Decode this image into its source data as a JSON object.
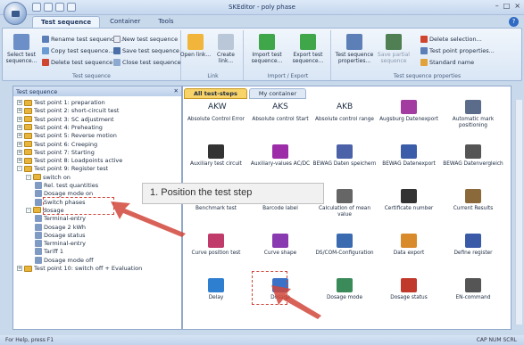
{
  "window": {
    "title": "SKEditor - poly phase",
    "controls": [
      "–",
      "□",
      "×"
    ]
  },
  "ribbon_tabs": [
    "Test sequence",
    "Container",
    "Tools"
  ],
  "ribbon": {
    "test_sequence_group": {
      "label": "Test sequence",
      "select_btn": "Select test sequence...",
      "rename": "Rename test sequence...",
      "copy": "Copy test sequence...",
      "delete": "Delete test sequence...",
      "new": "New test sequence",
      "save": "Save test sequence",
      "close": "Close test sequence"
    },
    "link_group": {
      "label": "Link",
      "open": "Open link...",
      "create": "Create link..."
    },
    "import_group": {
      "label": "Import / Export",
      "import": "Import test sequence...",
      "export": "Export test sequence..."
    },
    "properties_group": {
      "label": "Test sequence properties",
      "props": "Test sequence properties...",
      "save_partial": "Save partial sequence",
      "delete_sel": "Delete selection...",
      "test_point_props": "Test point properties...",
      "standard_name": "Standard name"
    }
  },
  "left_panel": {
    "title": "Test sequence",
    "tree": [
      "Test point 1: preparation",
      "Test point 2: short-circuit test",
      "Test point 3: SC adjustment",
      "Test point 4: Preheating",
      "Test point 5: Reverse motion",
      "Test point 6: Creeping",
      "Test point 7: Starting",
      "Test point 8: Loadpoints active",
      "Test point 9: Register test",
      "switch on",
      "Rel. test quantities",
      "Dosage mode on",
      "Switch phases",
      "dosage",
      "Terminal-entry",
      "Dosage 2 kWh",
      "Dosage status",
      "Terminal-entry",
      "Tariff 1",
      "Dosage mode off",
      "Test point 10: switch off + Evaluation"
    ]
  },
  "doc_tabs": [
    "All test-steps",
    "My container"
  ],
  "steps": [
    "Absolute Control Error",
    "Absolute control Start",
    "Absolute control range",
    "Augsburg Datenexport",
    "Automatic mark positioning",
    "Auxiliary test circuit",
    "Auxiliary-values AC/DC",
    "BEWAG Daten speichern",
    "BEWAG Datenexport",
    "BEWAG Datenvergleich",
    "Benchmark test",
    "Barcode label",
    "Calculation of mean value",
    "Certificate number",
    "Current Results",
    "Curve position test",
    "Curve shape",
    "DS/COM-Configuration",
    "Data export",
    "Define register",
    "Delay",
    "Dosage",
    "Dosage mode",
    "Dosage status",
    "EN-command"
  ],
  "step_icon_text": [
    "AKW",
    "AKS",
    "AKB"
  ],
  "callout": "1. Position the test step",
  "status": {
    "left": "For Help, press F1",
    "right": "CAP NUM SCRL"
  },
  "colors": {
    "highlight": "#d1463b",
    "accent": "#f8d36a"
  }
}
